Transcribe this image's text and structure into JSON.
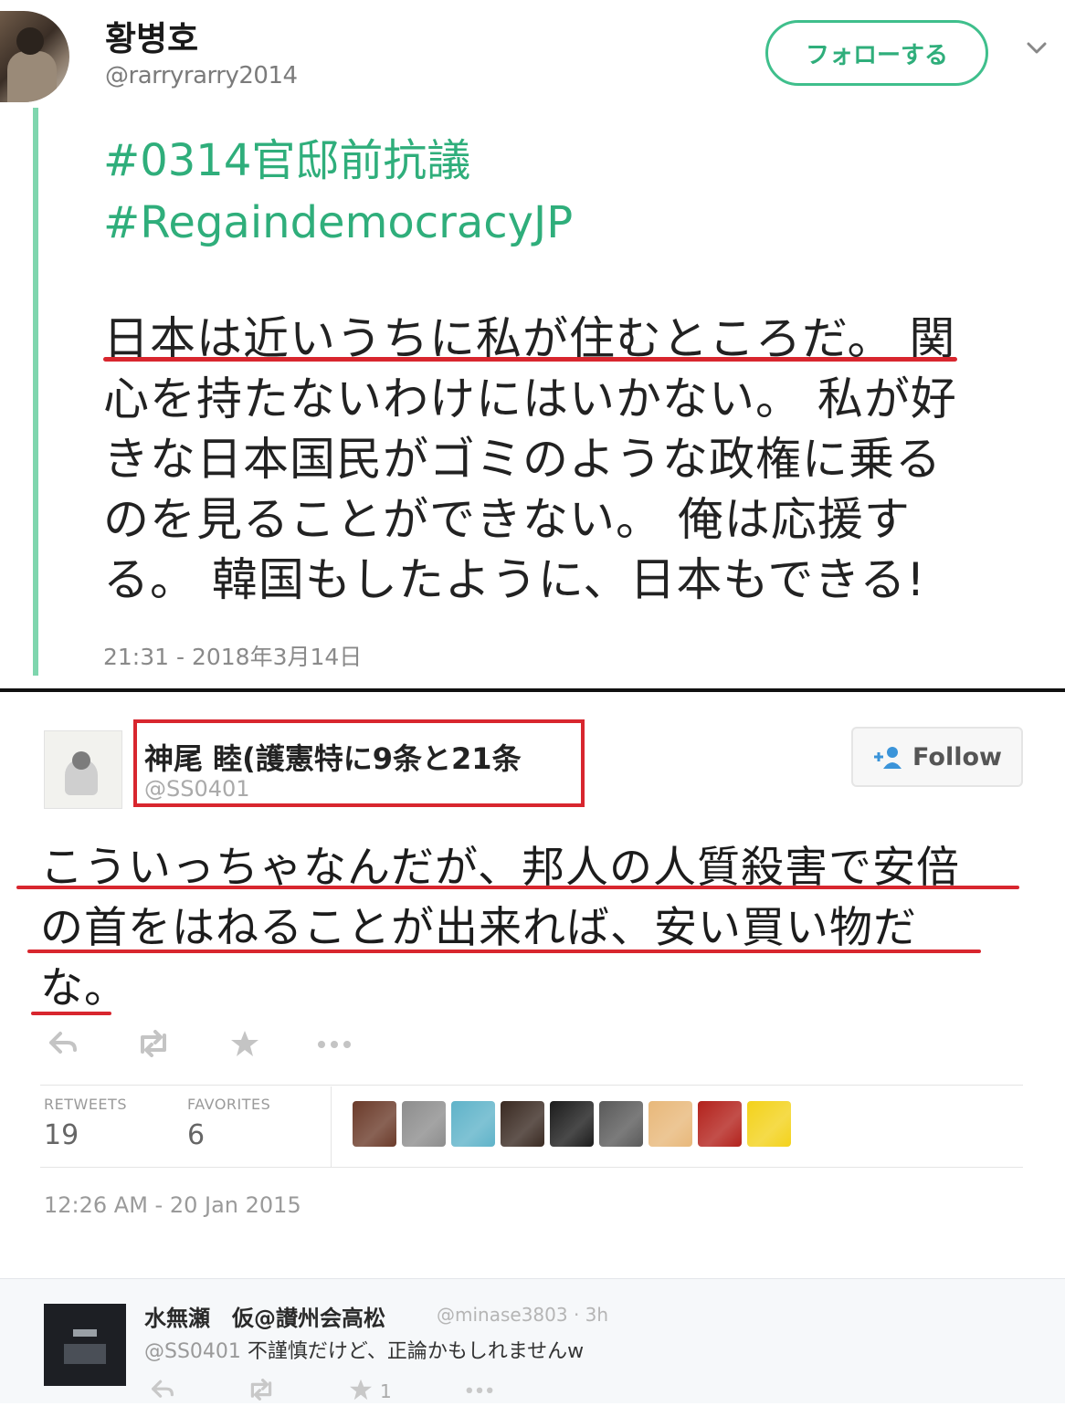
{
  "tweet1": {
    "display_name": "황병호",
    "handle": "@rarryrarry2014",
    "follow_label": "フォローする",
    "hashtags": [
      "#0314官邸前抗議",
      "#RegaindemocracyJP"
    ],
    "body_lines": [
      "日本は近いうちに私が住むところだ。 関",
      "心を持たないわけにはいかない。 私が好",
      "きな日本国民がゴミのような政権に乗る",
      "のを見ることができない。 俺は応援す",
      "る。 韓国もしたように、日本もできる!"
    ],
    "timestamp": "21:31 - 2018年3月14日"
  },
  "tweet2": {
    "display_name": "神尾 睦(護憲特に9条と21条",
    "handle": "@SS0401",
    "follow_label": "Follow",
    "body_lines": [
      "こういっちゃなんだが、邦人の人質殺害で安倍",
      "の首をはねることが出来れば、安い買い物だ",
      "な。"
    ],
    "stats": {
      "retweets_label": "RETWEETS",
      "retweets_value": "19",
      "favorites_label": "FAVORITES",
      "favorites_value": "6"
    },
    "timestamp": "12:26 AM - 20 Jan 2015",
    "favoriter_colors": [
      "#6b3b2a",
      "#8d8d8d",
      "#5fb3c9",
      "#3a2a22",
      "#1c1c1c",
      "#5a5a5a",
      "#e8b87a",
      "#b3221c",
      "#f3d21b"
    ]
  },
  "reply": {
    "display_name": "水無瀬　仮@讃州会高松",
    "handle_time": "@minase3803 · 3h",
    "mention": "@SS0401",
    "text": " 不謹慎だけど、正論かもしれませんw",
    "fav_count": "1"
  },
  "colors": {
    "accent_green": "#2fae7b",
    "underline_red": "#d8262e"
  }
}
